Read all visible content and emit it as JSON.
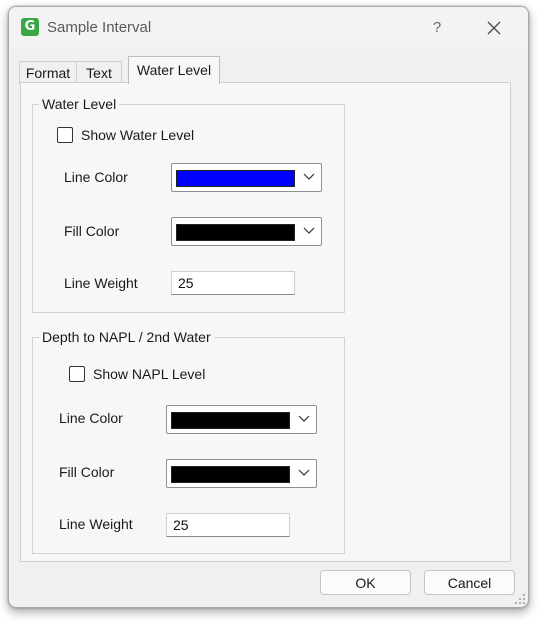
{
  "window": {
    "title": "Sample Interval",
    "app_icon": "app-logo-icon",
    "help_label": "?"
  },
  "tabs": [
    {
      "label": "Format",
      "active": false
    },
    {
      "label": "Text",
      "active": false
    },
    {
      "label": "Water Level",
      "active": true
    }
  ],
  "water_level": {
    "group_title": "Water Level",
    "show_label": "Show Water Level",
    "show_checked": false,
    "line_color_label": "Line Color",
    "line_color": "#0000ff",
    "fill_color_label": "Fill Color",
    "fill_color": "#000000",
    "line_weight_label": "Line Weight",
    "line_weight": "25"
  },
  "napl": {
    "group_title": "Depth to NAPL / 2nd Water",
    "show_label": "Show NAPL Level",
    "show_checked": false,
    "line_color_label": "Line Color",
    "line_color": "#000000",
    "fill_color_label": "Fill Color",
    "fill_color": "#000000",
    "line_weight_label": "Line Weight",
    "line_weight": "25"
  },
  "footer": {
    "ok_label": "OK",
    "cancel_label": "Cancel"
  }
}
